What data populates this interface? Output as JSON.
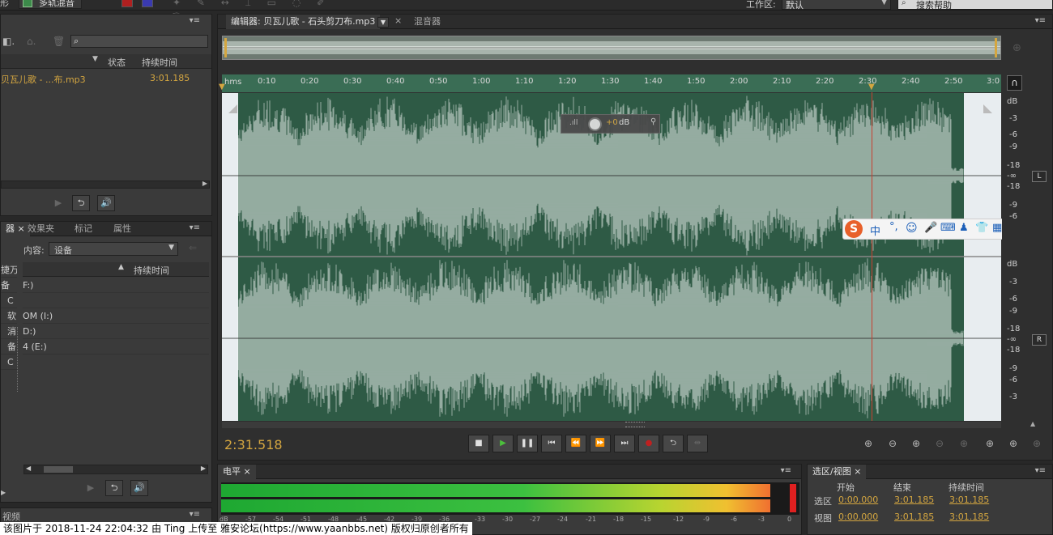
{
  "top": {
    "tab_partial": "形",
    "multitrack_label": "多轨混音",
    "workspace_label": "工作区:",
    "workspace_value": "默认",
    "search_placeholder": "搜索帮助"
  },
  "files_panel": {
    "col_status": "状态",
    "col_duration": "持续时间",
    "files": [
      {
        "name": "贝瓦儿歌 - ...布.mp3",
        "duration": "3:01.185"
      }
    ]
  },
  "browser_panel": {
    "tabs": [
      "器",
      "效果夹",
      "标记",
      "属性"
    ],
    "content_label": "内容:",
    "content_value": "设备",
    "col_duration": "持续时间",
    "side_items": [
      "捷万",
      "备",
      "C",
      "软",
      "消",
      "备",
      "C"
    ],
    "drives": [
      "F:)",
      "",
      "OM (I:)",
      "D:)",
      "4 (E:)"
    ]
  },
  "editor": {
    "tab_label": "编辑器: 贝瓦儿歌 - 石头剪刀布.mp3",
    "mixer_tab": "混音器",
    "time_unit": "hms",
    "ticks": [
      "0:10",
      "0:20",
      "0:30",
      "0:40",
      "0:50",
      "1:00",
      "1:10",
      "1:20",
      "1:30",
      "1:40",
      "1:50",
      "2:00",
      "2:10",
      "2:20",
      "2:30",
      "2:40",
      "2:50",
      "3:0"
    ],
    "hud_gain": "+0",
    "hud_unit": "dB",
    "db_label": "dB",
    "db_scale": [
      "-3",
      "-6",
      "-9",
      "-18",
      "-∞",
      "-18",
      "-9",
      "-6",
      "-3"
    ],
    "channel_L": "L",
    "channel_R": "R",
    "current_time": "2:31.518",
    "ime_text": "中"
  },
  "level_panel": {
    "tab": "电平",
    "scale": [
      "dB",
      "-57",
      "-54",
      "-51",
      "-48",
      "-45",
      "-42",
      "-39",
      "-36",
      "-33",
      "-30",
      "-27",
      "-24",
      "-21",
      "-18",
      "-15",
      "-12",
      "-9",
      "-6",
      "-3",
      "0"
    ]
  },
  "selection_panel": {
    "tab": "选区/视图",
    "col_start": "开始",
    "col_end": "结束",
    "col_duration": "持续时间",
    "rows": [
      {
        "label": "选区",
        "start": "0:00.000",
        "end": "3:01.185",
        "duration": "3:01.185"
      },
      {
        "label": "视图",
        "start": "0:00.000",
        "end": "3:01.185",
        "duration": "3:01.185"
      }
    ]
  },
  "video_panel": {
    "tab": "视频"
  },
  "watermark": "该图片于 2018-11-24 22:04:32 由 Ting 上传至 雅安论坛(https://www.yaanbbs.net) 版权归原创者所有",
  "colors": {
    "waveform_bg": "#2e5a45",
    "waveform": "#ffffff",
    "accent": "#d4a640",
    "playhead": "#c84030"
  }
}
